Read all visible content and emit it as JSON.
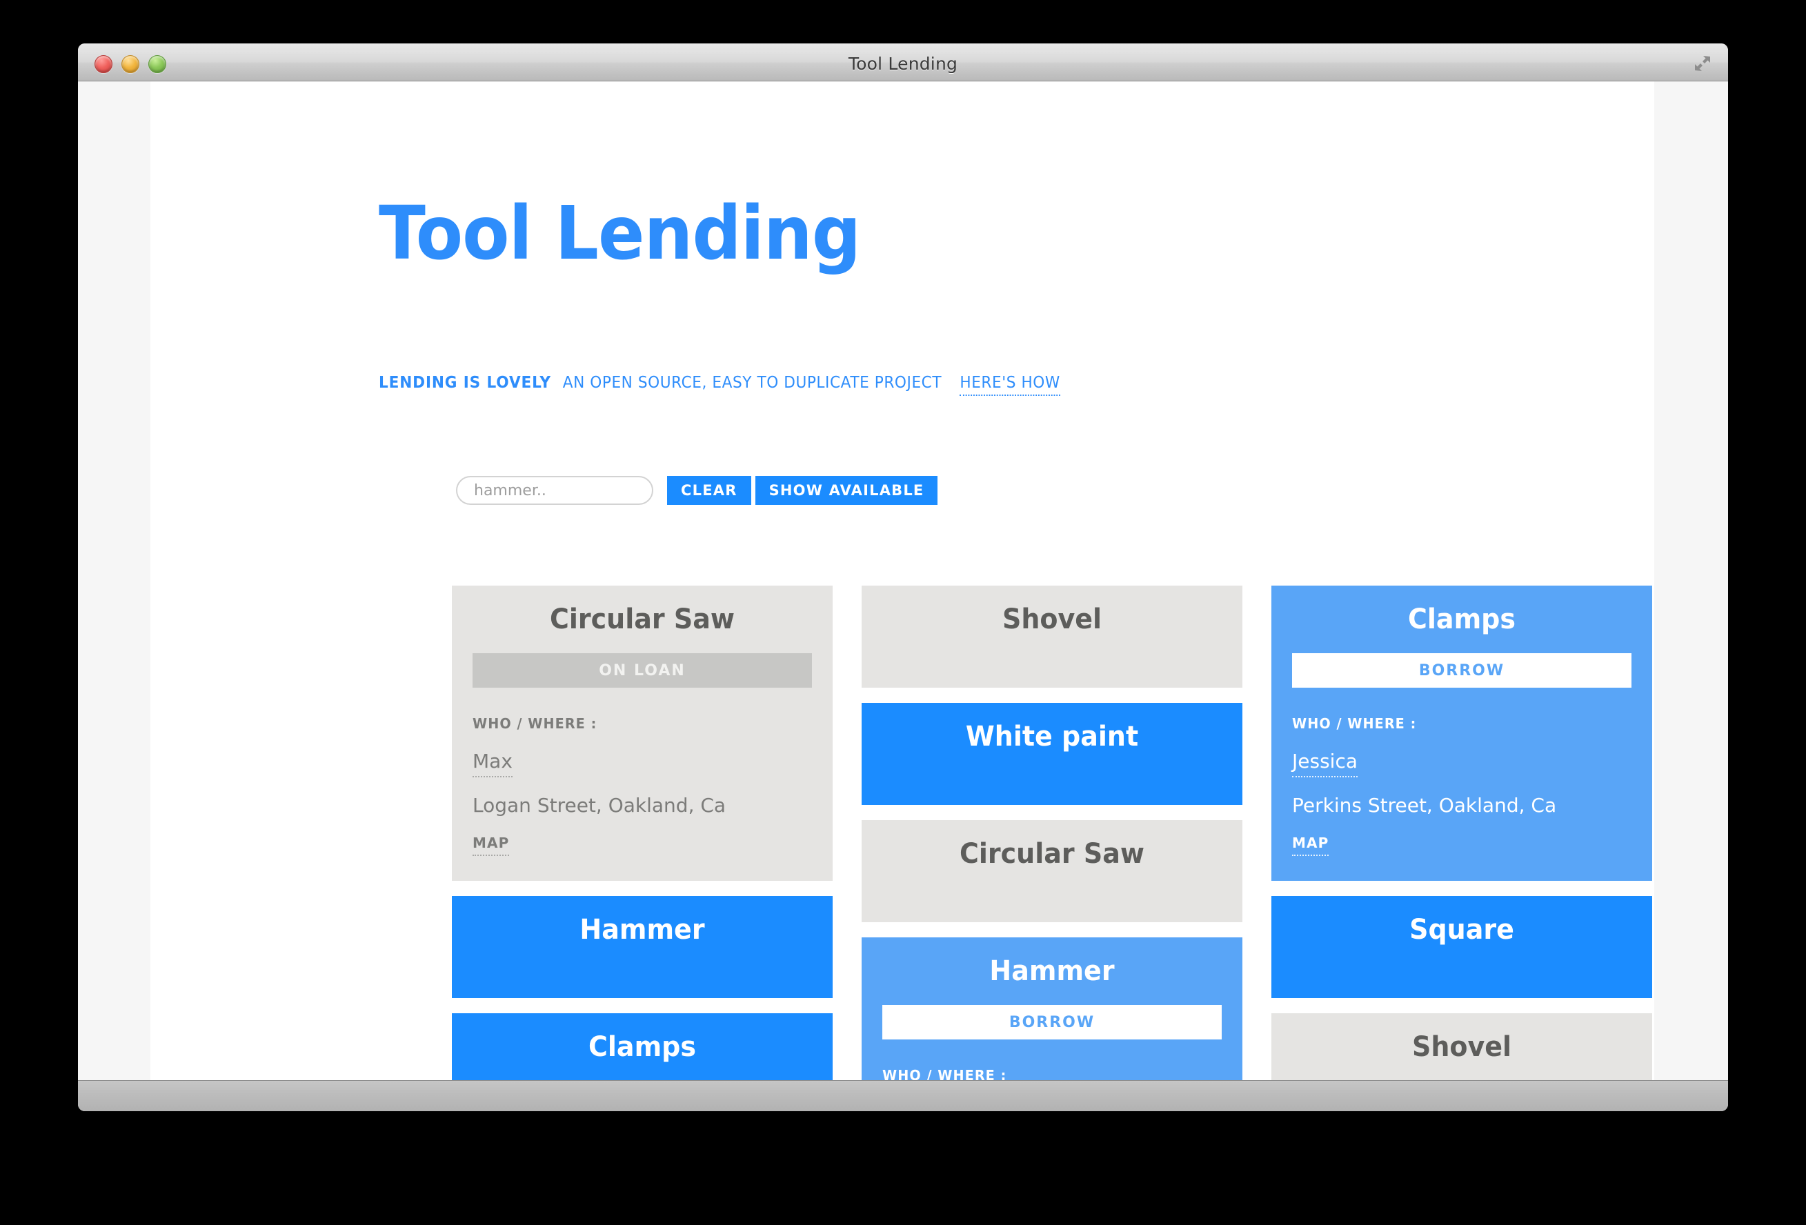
{
  "window": {
    "title": "Tool Lending",
    "traffic_lights": [
      "close",
      "minimize",
      "zoom"
    ],
    "fullscreen_icon": "fullscreen-arrows-icon"
  },
  "header": {
    "headline": "Tool Lending",
    "tagline_strong": "LENDING IS LOVELY",
    "tagline_regular": "AN OPEN SOURCE, EASY TO DUPLICATE PROJECT",
    "tagline_link": "HERE'S HOW"
  },
  "search": {
    "value": "",
    "placeholder": "hammer..",
    "clear_label": "CLEAR",
    "show_available_label": "SHOW AVAILABLE"
  },
  "labels": {
    "who_where": "WHO / WHERE :",
    "map": "MAP",
    "on_loan": "ON LOAN",
    "borrow": "BORROW"
  },
  "colors": {
    "accent_blue": "#1b8cff",
    "light_blue": "#59a5f7",
    "headline_blue": "#2e8dfb",
    "card_gray": "#e5e4e2",
    "on_loan_gray": "#c7c7c5",
    "gray_text": "#5d5d5b"
  },
  "columns": [
    {
      "cards": [
        {
          "name": "Circular Saw",
          "state": "gray",
          "expanded": true,
          "status": "ON LOAN",
          "status_kind": "onloan",
          "person": "Max",
          "address": "Logan Street, Oakland, Ca"
        },
        {
          "name": "Hammer",
          "state": "blue",
          "expanded": false,
          "tall": true
        },
        {
          "name": "Clamps",
          "state": "blue",
          "expanded": false,
          "tall": true
        }
      ]
    },
    {
      "cards": [
        {
          "name": "Shovel",
          "state": "gray",
          "expanded": false,
          "tall": true
        },
        {
          "name": "White paint",
          "state": "blue",
          "expanded": false,
          "tall": true
        },
        {
          "name": "Circular Saw",
          "state": "gray",
          "expanded": false,
          "tall": true
        },
        {
          "name": "Hammer",
          "state": "lblue",
          "expanded": true,
          "status": "BORROW",
          "status_kind": "borrow",
          "person": "",
          "address": ""
        }
      ]
    },
    {
      "cards": [
        {
          "name": "Clamps",
          "state": "lblue",
          "expanded": true,
          "status": "BORROW",
          "status_kind": "borrow",
          "person": "Jessica",
          "address": "Perkins Street, Oakland, Ca"
        },
        {
          "name": "Square",
          "state": "blue",
          "expanded": false,
          "tall": true
        },
        {
          "name": "Shovel",
          "state": "gray",
          "expanded": false,
          "tall": true
        }
      ]
    }
  ]
}
